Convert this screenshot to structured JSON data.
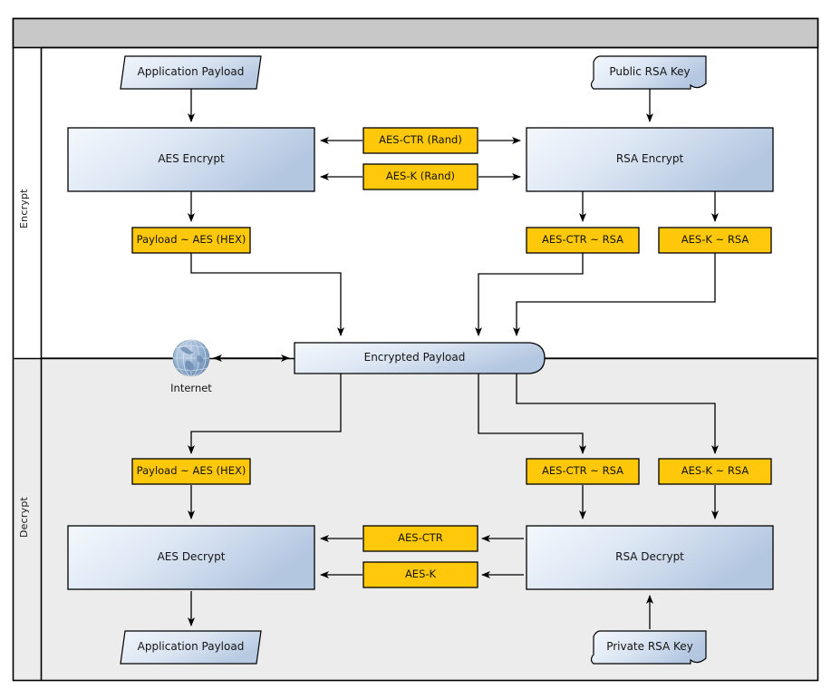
{
  "diagram": {
    "title_bar": {
      "label": ""
    },
    "lanes": [
      {
        "name": "encrypt",
        "label": "Encrypt"
      },
      {
        "name": "decrypt",
        "label": "Decrypt"
      }
    ],
    "colors": {
      "header_gray": "#c8c8c8",
      "lane_encrypt_bg": "#ffffff",
      "lane_decrypt_bg": "#ececec",
      "process_fill_light": "#f2f6fc",
      "process_fill_dark": "#b3c6e0",
      "data_yellow": "#ffc80a",
      "stroke": "#000000",
      "globe_blue": "#7e9ec4"
    },
    "nodes": {
      "app_payload_in": {
        "label": "Application Payload",
        "shape": "parallelogram"
      },
      "public_rsa_key": {
        "label": "Public RSA Key",
        "shape": "tape"
      },
      "aes_encrypt": {
        "label": "AES Encrypt",
        "shape": "process"
      },
      "rsa_encrypt": {
        "label": "RSA Encrypt",
        "shape": "process"
      },
      "aes_ctr_rand": {
        "label": "AES-CTR (Rand)",
        "shape": "data"
      },
      "aes_k_rand": {
        "label": "AES-K (Rand)",
        "shape": "data"
      },
      "payload_aes_hex_top": {
        "label": "Payload ~ AES (HEX)",
        "shape": "data"
      },
      "aes_ctr_rsa_top": {
        "label": "AES-CTR ~ RSA",
        "shape": "data"
      },
      "aes_k_rsa_top": {
        "label": "AES-K ~ RSA",
        "shape": "data"
      },
      "encrypted_payload": {
        "label": "Encrypted Payload",
        "shape": "tape"
      },
      "internet": {
        "label": "Internet",
        "shape": "globe-icon"
      },
      "payload_aes_hex_bottom": {
        "label": "Payload ~ AES (HEX)",
        "shape": "data"
      },
      "aes_ctr_rsa_bottom": {
        "label": "AES-CTR ~ RSA",
        "shape": "data"
      },
      "aes_k_rsa_bottom": {
        "label": "AES-K ~ RSA",
        "shape": "data"
      },
      "aes_decrypt": {
        "label": "AES Decrypt",
        "shape": "process"
      },
      "rsa_decrypt": {
        "label": "RSA Decrypt",
        "shape": "process"
      },
      "aes_ctr": {
        "label": "AES-CTR",
        "shape": "data"
      },
      "aes_k": {
        "label": "AES-K",
        "shape": "data"
      },
      "private_rsa_key": {
        "label": "Private RSA Key",
        "shape": "tape"
      },
      "app_payload_out": {
        "label": "Application Payload",
        "shape": "parallelogram"
      }
    }
  }
}
